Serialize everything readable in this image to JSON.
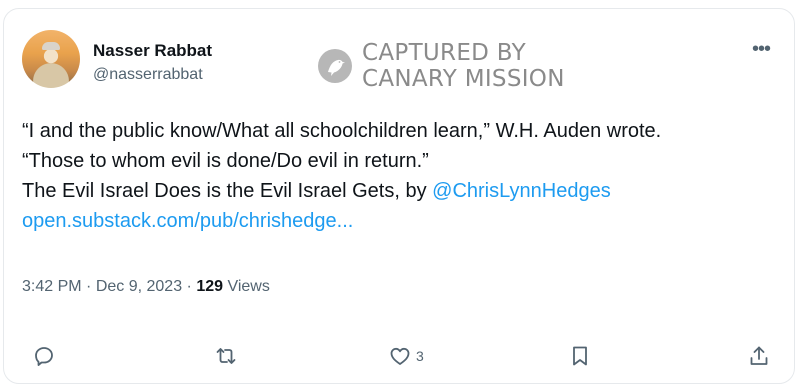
{
  "author": {
    "name": "Nasser Rabbat",
    "handle": "@nasserrabbat"
  },
  "watermark": {
    "line1": "CAPTURED BY",
    "line2": "CANARY MISSION"
  },
  "more_icon": "more-horizontal",
  "tweet": {
    "line1": "“I and the public know/What all schoolchildren learn,” W.H. Auden wrote.",
    "line2": "“Those to whom evil is done/Do evil in return.”",
    "line3_prefix": "The Evil Israel Does is the Evil Israel Gets, by ",
    "mention": "@ChrisLynnHedges",
    "link": "open.substack.com/pub/chrishedge..."
  },
  "meta": {
    "time": "3:42 PM",
    "sep1": " · ",
    "date": "Dec 9, 2023",
    "sep2": " · ",
    "views_count": "129",
    "views_label": " Views"
  },
  "actions": {
    "reply_icon": "reply-icon",
    "retweet_icon": "retweet-icon",
    "like_icon": "heart-icon",
    "like_count": "3",
    "bookmark_icon": "bookmark-icon",
    "share_icon": "share-icon"
  },
  "colors": {
    "text": "#0f1419",
    "secondary": "#536471",
    "link": "#1d9bf0",
    "watermark": "#8a8a8a"
  }
}
